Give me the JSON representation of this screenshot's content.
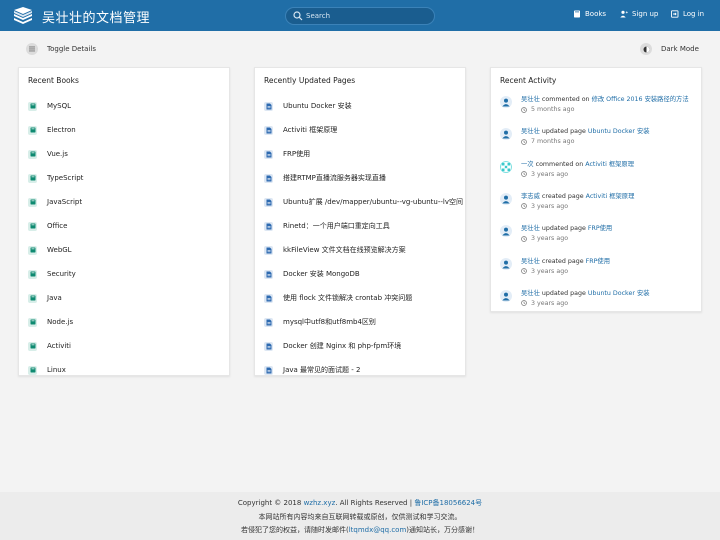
{
  "header": {
    "title": "吴壮壮的文档管理",
    "search_placeholder": "Search",
    "nav": {
      "books": "Books",
      "signup": "Sign up",
      "login": "Log in"
    },
    "bg_color": "#206ea7"
  },
  "toolbar": {
    "toggle_details": "Toggle Details",
    "dark_mode": "Dark Mode"
  },
  "recent_books": {
    "title": "Recent Books",
    "items": [
      "MySQL",
      "Electron",
      "Vue.js",
      "TypeScript",
      "JavaScript",
      "Office",
      "WebGL",
      "Security",
      "Java",
      "Node.js",
      "Activiti",
      "Linux"
    ]
  },
  "recent_pages": {
    "title": "Recently Updated Pages",
    "items": [
      "Ubuntu Docker 安装",
      "Activiti 框架原理",
      "FRP使用",
      "搭建RTMP直播流服务器实现直播",
      "Ubuntu扩展 /dev/mapper/ubuntu--vg-ubuntu--lv空间",
      "Rinetd：一个用户端口重定向工具",
      "kkFileView 文件文档在线预览解决方案",
      "Docker 安装 MongoDB",
      "使用 flock 文件锁解决 crontab 冲突问题",
      "mysql中utf8和utf8mb4区别",
      "Docker 创建 Nginx 和 php-fpm环境",
      "Java 最常见的面试题 - 2"
    ]
  },
  "activity": {
    "title": "Recent Activity",
    "items": [
      {
        "user": "吴壮壮",
        "action": "commented on",
        "target": "修改 Office 2016 安装路径的方法",
        "time": "5 months ago"
      },
      {
        "user": "吴壮壮",
        "action": "updated page",
        "target": "Ubuntu Docker 安装",
        "time": "7 months ago"
      },
      {
        "user": "一次",
        "action": "commented on",
        "target": "Activiti 框架原理",
        "time": "3 years ago"
      },
      {
        "user": "李志威",
        "action": "created page",
        "target": "Activiti 框架原理",
        "time": "3 years ago"
      },
      {
        "user": "吴壮壮",
        "action": "updated page",
        "target": "FRP使用",
        "time": "3 years ago"
      },
      {
        "user": "吴壮壮",
        "action": "created page",
        "target": "FRP使用",
        "time": "3 years ago"
      },
      {
        "user": "吴壮壮",
        "action": "updated page",
        "target": "Ubuntu Docker 安装",
        "time": "3 years ago"
      }
    ]
  },
  "footer": {
    "copyright_prefix": "Copyright © 2018",
    "site": "wzhz.xyz",
    "rights": ". All Rights Reserved |",
    "icp": "鲁ICP备18056624号",
    "line2": "本网站所有内容均来自互联网转载或原创，仅供测试和学习交流。",
    "line3_prefix": "若侵犯了您的权益，请随时发邮件(",
    "email": "ltqmdx@qq.com",
    "line3_suffix": ")通知站长，万分感谢！"
  },
  "colors": {
    "book_icon": "#0e8a71",
    "page_icon": "#2d6ab0",
    "link": "#206ea7"
  }
}
